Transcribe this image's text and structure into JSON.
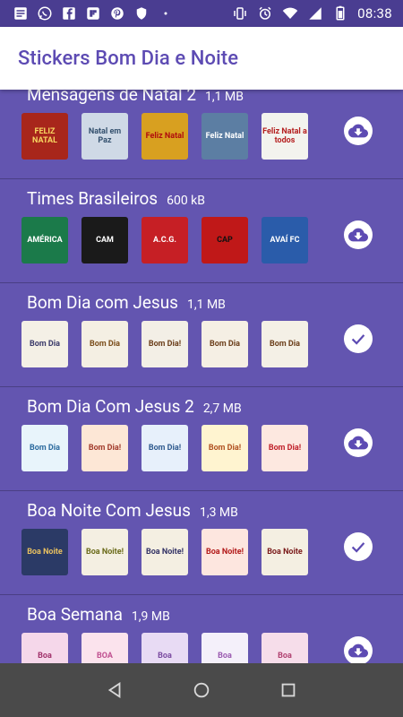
{
  "status_bar": {
    "time": "08:38",
    "left_icons": [
      "message-icon",
      "whatsapp-icon",
      "facebook-icon",
      "flipboard-icon",
      "pinterest-icon",
      "shield-icon",
      "more-dots-icon"
    ],
    "right_icons": [
      "vibrate-icon",
      "alarm-icon",
      "wifi-icon",
      "signal-icon",
      "battery-icon"
    ]
  },
  "app": {
    "title": "Stickers Bom Dia e Noite"
  },
  "packs": [
    {
      "title": "Mensagens de Natal 2",
      "size": "1,1 MB",
      "action": "download",
      "thumbs": [
        {
          "label": "FELIZ NATAL",
          "bg": "#a8261b",
          "fg": "#f7d560"
        },
        {
          "label": "Natal em Paz",
          "bg": "#cfd9e6",
          "fg": "#34506e"
        },
        {
          "label": "Feliz Natal",
          "bg": "#d8a020",
          "fg": "#b00d0d"
        },
        {
          "label": "Feliz Natal",
          "bg": "#5c7ea3",
          "fg": "#ffffff"
        },
        {
          "label": "Feliz Natal a todos",
          "bg": "#f3f3ee",
          "fg": "#b52020"
        }
      ]
    },
    {
      "title": "Times Brasileiros",
      "size": "600 kB",
      "action": "download",
      "thumbs": [
        {
          "label": "AMÉRICA",
          "bg": "#1b7a4a",
          "fg": "#ffffff"
        },
        {
          "label": "CAM",
          "bg": "#1a1a1a",
          "fg": "#ffffff"
        },
        {
          "label": "A.C.G.",
          "bg": "#c61f25",
          "fg": "#ffffff"
        },
        {
          "label": "CAP",
          "bg": "#c01818",
          "fg": "#111111"
        },
        {
          "label": "AVAÍ FC",
          "bg": "#2a5caa",
          "fg": "#ffffff"
        }
      ]
    },
    {
      "title": "Bom Dia com Jesus",
      "size": "1,1 MB",
      "action": "check",
      "thumbs": [
        {
          "label": "Bom Dia",
          "bg": "#f4f0e6",
          "fg": "#3a3a6a"
        },
        {
          "label": "Bom Dia",
          "bg": "#f4efe3",
          "fg": "#7a4d1a"
        },
        {
          "label": "Bom Dia!",
          "bg": "#f3efe6",
          "fg": "#6b3e1a"
        },
        {
          "label": "Bom Dia",
          "bg": "#f5efe4",
          "fg": "#6b3e1a"
        },
        {
          "label": "Bom Dia",
          "bg": "#f4f0e6",
          "fg": "#6b3e1a"
        }
      ]
    },
    {
      "title": "Bom Dia Com Jesus 2",
      "size": "2,7 MB",
      "action": "download",
      "thumbs": [
        {
          "label": "Bom Dia",
          "bg": "#e8f4fb",
          "fg": "#2b6a9e"
        },
        {
          "label": "Bom Dia!",
          "bg": "#fde7d6",
          "fg": "#a23b2c"
        },
        {
          "label": "Bom Dia!",
          "bg": "#e7f0fb",
          "fg": "#2f5a8e"
        },
        {
          "label": "Bom Dia!",
          "bg": "#fff4d0",
          "fg": "#b05020"
        },
        {
          "label": "Bom Dia!",
          "bg": "#fde8e0",
          "fg": "#c0202a"
        }
      ]
    },
    {
      "title": "Boa Noite Com Jesus",
      "size": "1,3 MB",
      "action": "check",
      "thumbs": [
        {
          "label": "Boa Noite",
          "bg": "#2b3a66",
          "fg": "#e8c060"
        },
        {
          "label": "Boa Noite!",
          "bg": "#f4efe2",
          "fg": "#6b6b1a"
        },
        {
          "label": "Boa Noite!",
          "bg": "#f4efe2",
          "fg": "#333366"
        },
        {
          "label": "Boa Noite!",
          "bg": "#fde6df",
          "fg": "#b31a1a"
        },
        {
          "label": "Boa Noite",
          "bg": "#f4efe2",
          "fg": "#7a1a1a"
        }
      ]
    },
    {
      "title": "Boa Semana",
      "size": "1,9 MB",
      "action": "download",
      "thumbs": [
        {
          "label": "Boa",
          "bg": "#f5d7ea",
          "fg": "#a0306a"
        },
        {
          "label": "BOA",
          "bg": "#fbe3ed",
          "fg": "#c05090"
        },
        {
          "label": "Boa",
          "bg": "#e8dbf4",
          "fg": "#7a4aa0"
        },
        {
          "label": "Boa",
          "bg": "#f4f0fa",
          "fg": "#9a5ab0"
        },
        {
          "label": "Boa",
          "bg": "#f6ddea",
          "fg": "#b04070"
        }
      ]
    }
  ],
  "colors": {
    "accent": "#5d4bb3",
    "list_bg": "#6355b0",
    "status_bar": "#4a3d91",
    "nav_bar": "#4a4a4a"
  }
}
